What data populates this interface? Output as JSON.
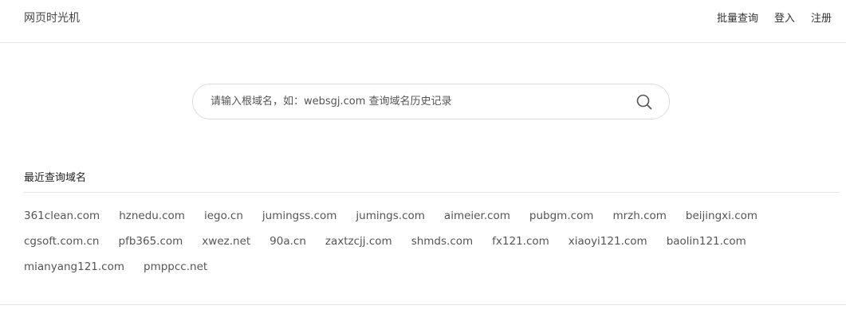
{
  "header": {
    "brand": "网页时光机",
    "nav": [
      "批量查询",
      "登入",
      "注册"
    ]
  },
  "search": {
    "value": "",
    "placeholder": "请输入根域名，如：websgj.com 查询域名历史记录",
    "icon": "search-icon"
  },
  "recent": {
    "title": "最近查询域名",
    "domains": [
      "361clean.com",
      "hznedu.com",
      "iego.cn",
      "jumingss.com",
      "jumings.com",
      "aimeier.com",
      "pubgm.com",
      "mrzh.com",
      "beijingxi.com",
      "cgsoft.com.cn",
      "pfb365.com",
      "xwez.net",
      "90a.cn",
      "zaxtzcjj.com",
      "shmds.com",
      "fx121.com",
      "xiaoyi121.com",
      "baolin121.com",
      "mianyang121.com",
      "pmppcc.net"
    ]
  }
}
